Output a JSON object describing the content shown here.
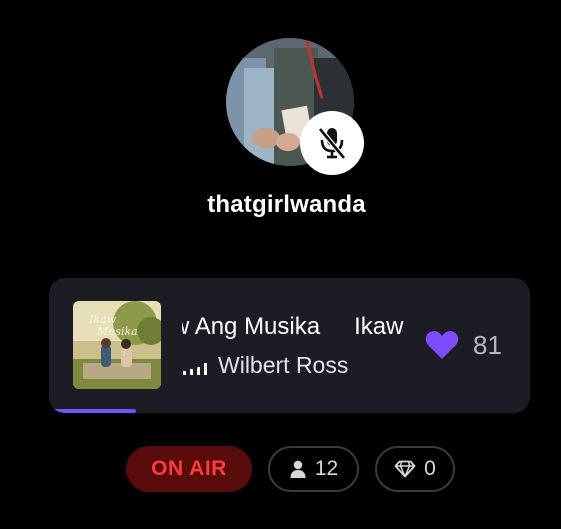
{
  "host": {
    "username": "thatgirlwanda",
    "mic_icon": "mic-off-icon"
  },
  "now_playing": {
    "title": "Ikaw Ang Musika",
    "artist": "Wilbert Ross",
    "likes": "81",
    "like_icon": "heart-icon",
    "progress_percent": 18
  },
  "status": {
    "on_air_label": "ON AIR",
    "listeners_count": "12",
    "gems_count": "0"
  },
  "colors": {
    "background": "#000000",
    "card": "#1c1c24",
    "accent": "#7b4dff",
    "on_air_bg": "#5a0c0c",
    "on_air_text": "#ff3b3b"
  }
}
